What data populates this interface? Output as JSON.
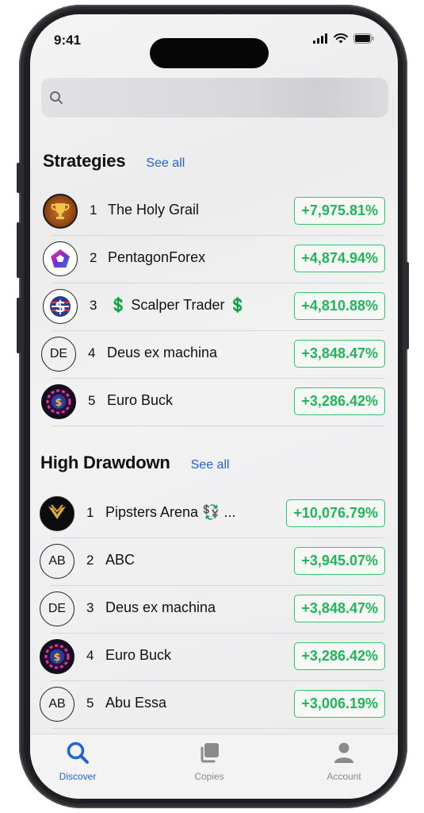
{
  "status": {
    "time": "9:41"
  },
  "search": {
    "placeholder": ""
  },
  "strategies": {
    "title": "Strategies",
    "see_all": "See all",
    "items": [
      {
        "rank": "1",
        "name": "The Holy Grail",
        "pct": "+7,975.81%",
        "avatar": "trophy-icon"
      },
      {
        "rank": "2",
        "name": "PentagonForex",
        "pct": "+4,874.94%",
        "avatar": "pentagon-logo-icon"
      },
      {
        "rank": "3",
        "name": "💲 Scalper Trader 💲",
        "pct": "+4,810.88%",
        "avatar": "dollar-icon"
      },
      {
        "rank": "4",
        "name": "Deus ex machina",
        "pct": "+3,848.47%",
        "initials": "DE"
      },
      {
        "rank": "5",
        "name": "Euro Buck",
        "pct": "+3,286.42%",
        "avatar": "euro-coin-icon"
      }
    ]
  },
  "high_drawdown": {
    "title": "High Drawdown",
    "see_all": "See all",
    "items": [
      {
        "rank": "1",
        "name": "Pipsters Arena 💱 ...",
        "pct": "+10,076.79%",
        "avatar": "spartan-helmet-icon"
      },
      {
        "rank": "2",
        "name": "ABC",
        "pct": "+3,945.07%",
        "initials": "AB"
      },
      {
        "rank": "3",
        "name": "Deus ex machina",
        "pct": "+3,848.47%",
        "initials": "DE"
      },
      {
        "rank": "4",
        "name": "Euro Buck",
        "pct": "+3,286.42%",
        "avatar": "euro-coin-icon"
      },
      {
        "rank": "5",
        "name": "Abu Essa",
        "pct": "+3,006.19%",
        "initials": "AB"
      }
    ]
  },
  "tabs": [
    {
      "label": "Discover",
      "icon": "search-icon",
      "active": true
    },
    {
      "label": "Copies",
      "icon": "copies-icon",
      "active": false
    },
    {
      "label": "Account",
      "icon": "person-icon",
      "active": false
    }
  ],
  "colors": {
    "accent": "#1e63d8",
    "positive": "#23b35b"
  }
}
